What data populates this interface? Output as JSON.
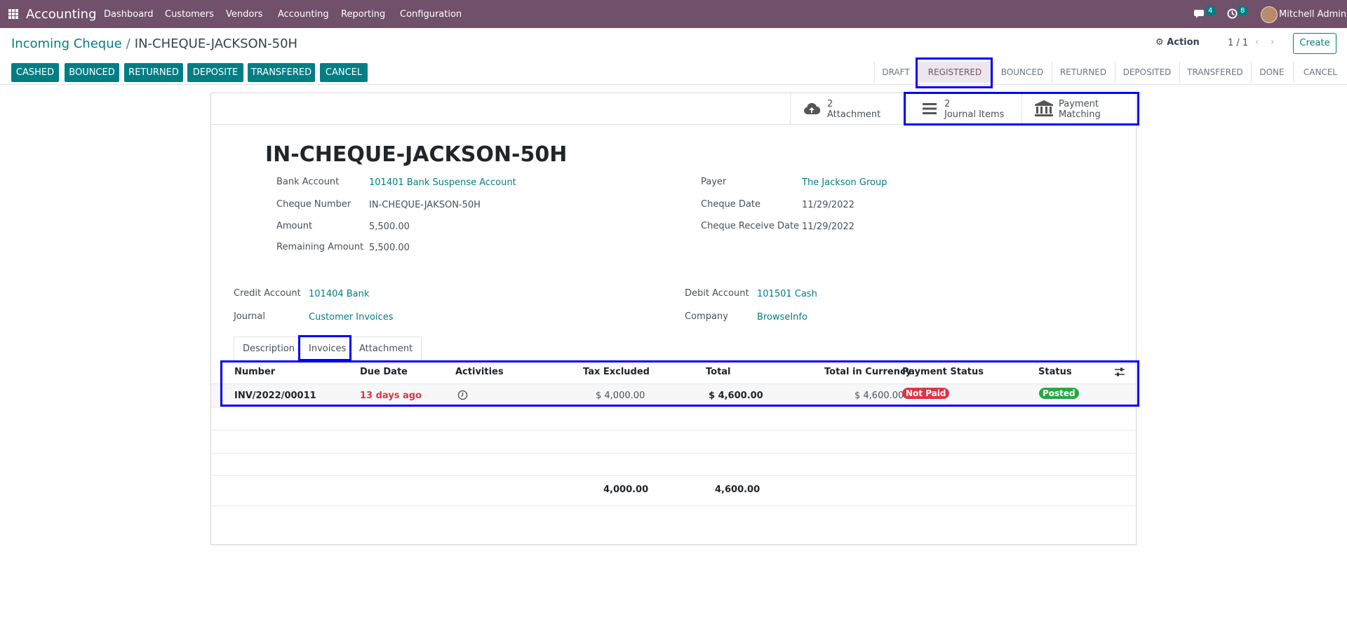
{
  "navbar": {
    "app_name": "Accounting",
    "menu": [
      "Dashboard",
      "Customers",
      "Vendors",
      "Accounting",
      "Reporting",
      "Configuration"
    ],
    "messages_count": "4",
    "activities_count": "8",
    "user": "Mitchell Admin"
  },
  "breadcrumb": {
    "parent": "Incoming Cheque",
    "current": "IN-CHEQUE-JACKSON-50H"
  },
  "control": {
    "action": "Action",
    "pager": "1 / 1",
    "create": "Create"
  },
  "header_buttons": [
    "CASHED",
    "BOUNCED",
    "RETURNED",
    "DEPOSITE",
    "TRANSFERED",
    "CANCEL"
  ],
  "statusbar": {
    "stages": [
      "DRAFT",
      "REGISTERED",
      "BOUNCED",
      "RETURNED",
      "DEPOSITED",
      "TRANSFERED",
      "DONE",
      "CANCEL"
    ],
    "current": "REGISTERED"
  },
  "smart_buttons": [
    {
      "count": "2",
      "label": "Attachment",
      "icon": "cloud-upload-icon"
    },
    {
      "count": "2",
      "label": "Journal Items",
      "icon": "list-icon"
    },
    {
      "count": "Payment",
      "label": "Matching",
      "icon": "bank-icon"
    }
  ],
  "record": {
    "title": "IN-CHEQUE-JACKSON-50H",
    "left_fields": [
      {
        "label": "Bank Account",
        "value": "101401 Bank Suspense Account"
      },
      {
        "label": "Cheque Number",
        "value": "IN-CHEQUE-JAKSON-50H"
      },
      {
        "label": "Amount",
        "value": "5,500.00"
      },
      {
        "label": "Remaining Amount",
        "value": "5,500.00"
      }
    ],
    "right_fields": [
      {
        "label": "Payer",
        "value": "The Jackson Group"
      },
      {
        "label": "Cheque Date",
        "value": "11/29/2022"
      },
      {
        "label": "Cheque Receive Date",
        "value": "11/29/2022"
      }
    ],
    "accounts_left": [
      {
        "label": "Credit Account",
        "value": "101404 Bank"
      },
      {
        "label": "Journal",
        "value": "Customer Invoices"
      }
    ],
    "accounts_right": [
      {
        "label": "Debit Account",
        "value": "101501 Cash"
      },
      {
        "label": "Company",
        "value": "BrowseInfo"
      }
    ]
  },
  "tabs": [
    "Description",
    "Invoices",
    "Attachment"
  ],
  "active_tab": "Invoices",
  "invoices": {
    "columns": [
      "Number",
      "Due Date",
      "Activities",
      "Tax Excluded",
      "Total",
      "Total in Currency",
      "Payment Status",
      "Status"
    ],
    "rows": [
      {
        "number": "INV/2022/00011",
        "due": "13 days ago",
        "tax_excluded": "$ 4,000.00",
        "total": "$ 4,600.00",
        "total_currency": "$ 4,600.00",
        "payment_status": "Not Paid",
        "status": "Posted"
      }
    ],
    "totals": {
      "tax_excluded": "4,000.00",
      "total": "4,600.00"
    }
  },
  "colors": {
    "brand": "#71506b",
    "accent": "#017e84",
    "danger": "#dc3545",
    "success": "#28a745",
    "highlight": "#0000ff"
  }
}
